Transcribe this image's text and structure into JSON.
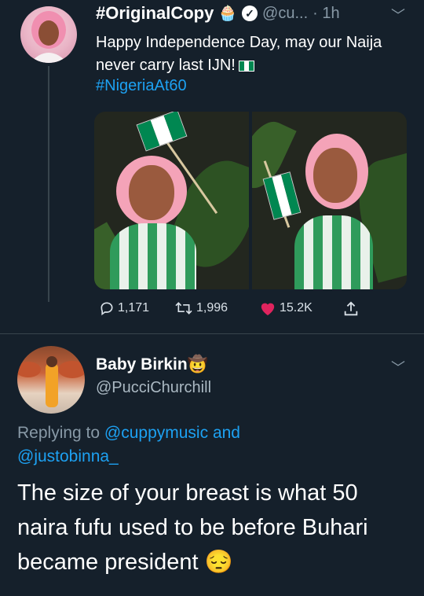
{
  "tweet": {
    "author_name": "#OriginalCopy",
    "author_emoji": "🧁",
    "handle": "@cu...",
    "time": "· 1h",
    "text": "Happy Independence Day, may our Naija never carry last IJN!",
    "hashtag": "#NigeriaAt60",
    "flag_colors": [
      "#008751",
      "#ffffff",
      "#008751"
    ],
    "stats": {
      "replies": "1,171",
      "retweets": "1,996",
      "likes": "15.2K"
    },
    "like_color": "#e0245e"
  },
  "reply": {
    "author_name": "Baby Birkin",
    "author_emoji": "🤠",
    "handle": "@PucciChurchill",
    "replying_prefix": "Replying to",
    "mention_1": "@cuppymusic",
    "and_word": "and",
    "mention_2": "@justobinna_",
    "text": "The size of your breast is what 50 naira fufu used to be before Buhari became president",
    "text_emoji": "😔"
  },
  "theme": {
    "background": "#15202b",
    "link": "#1da1f2",
    "muted": "#8899a6"
  }
}
